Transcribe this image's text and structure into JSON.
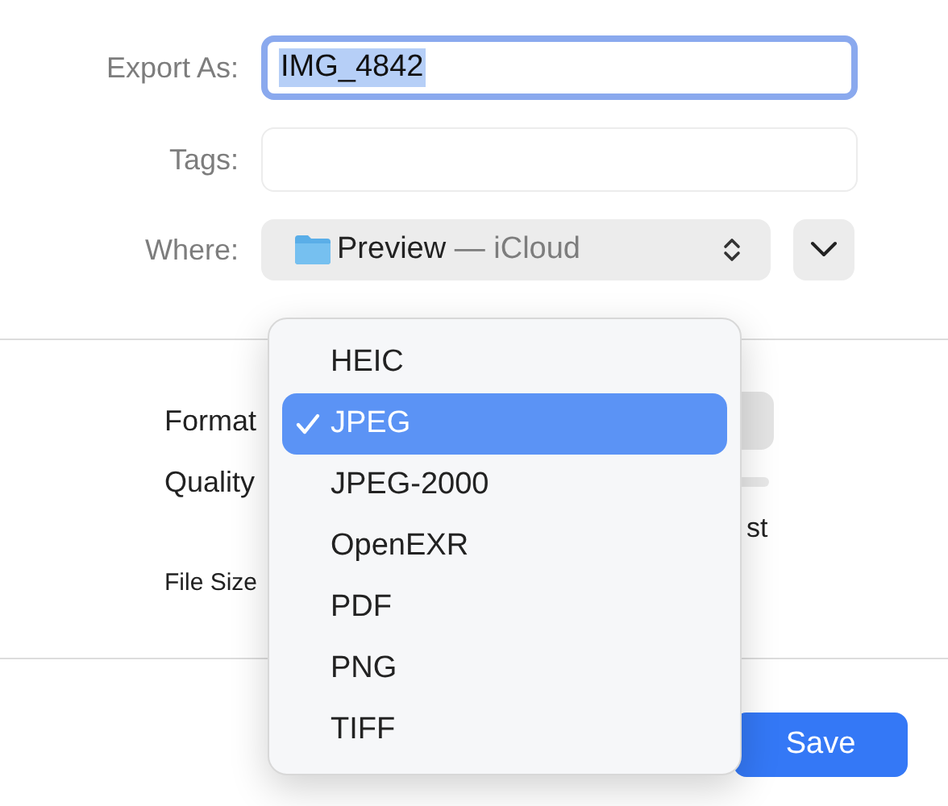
{
  "export_as": {
    "label": "Export As:",
    "value": "IMG_4842"
  },
  "tags": {
    "label": "Tags:"
  },
  "where": {
    "label": "Where:",
    "location": "Preview",
    "service": "— iCloud"
  },
  "options": {
    "format_label": "Format",
    "quality_label": "Quality",
    "partial_text": "st",
    "file_size_label": "File Size"
  },
  "format_menu": [
    {
      "label": "HEIC",
      "selected": false
    },
    {
      "label": "JPEG",
      "selected": true
    },
    {
      "label": "JPEG-2000",
      "selected": false
    },
    {
      "label": "OpenEXR",
      "selected": false
    },
    {
      "label": "PDF",
      "selected": false
    },
    {
      "label": "PNG",
      "selected": false
    },
    {
      "label": "TIFF",
      "selected": false
    }
  ],
  "buttons": {
    "save": "Save"
  }
}
